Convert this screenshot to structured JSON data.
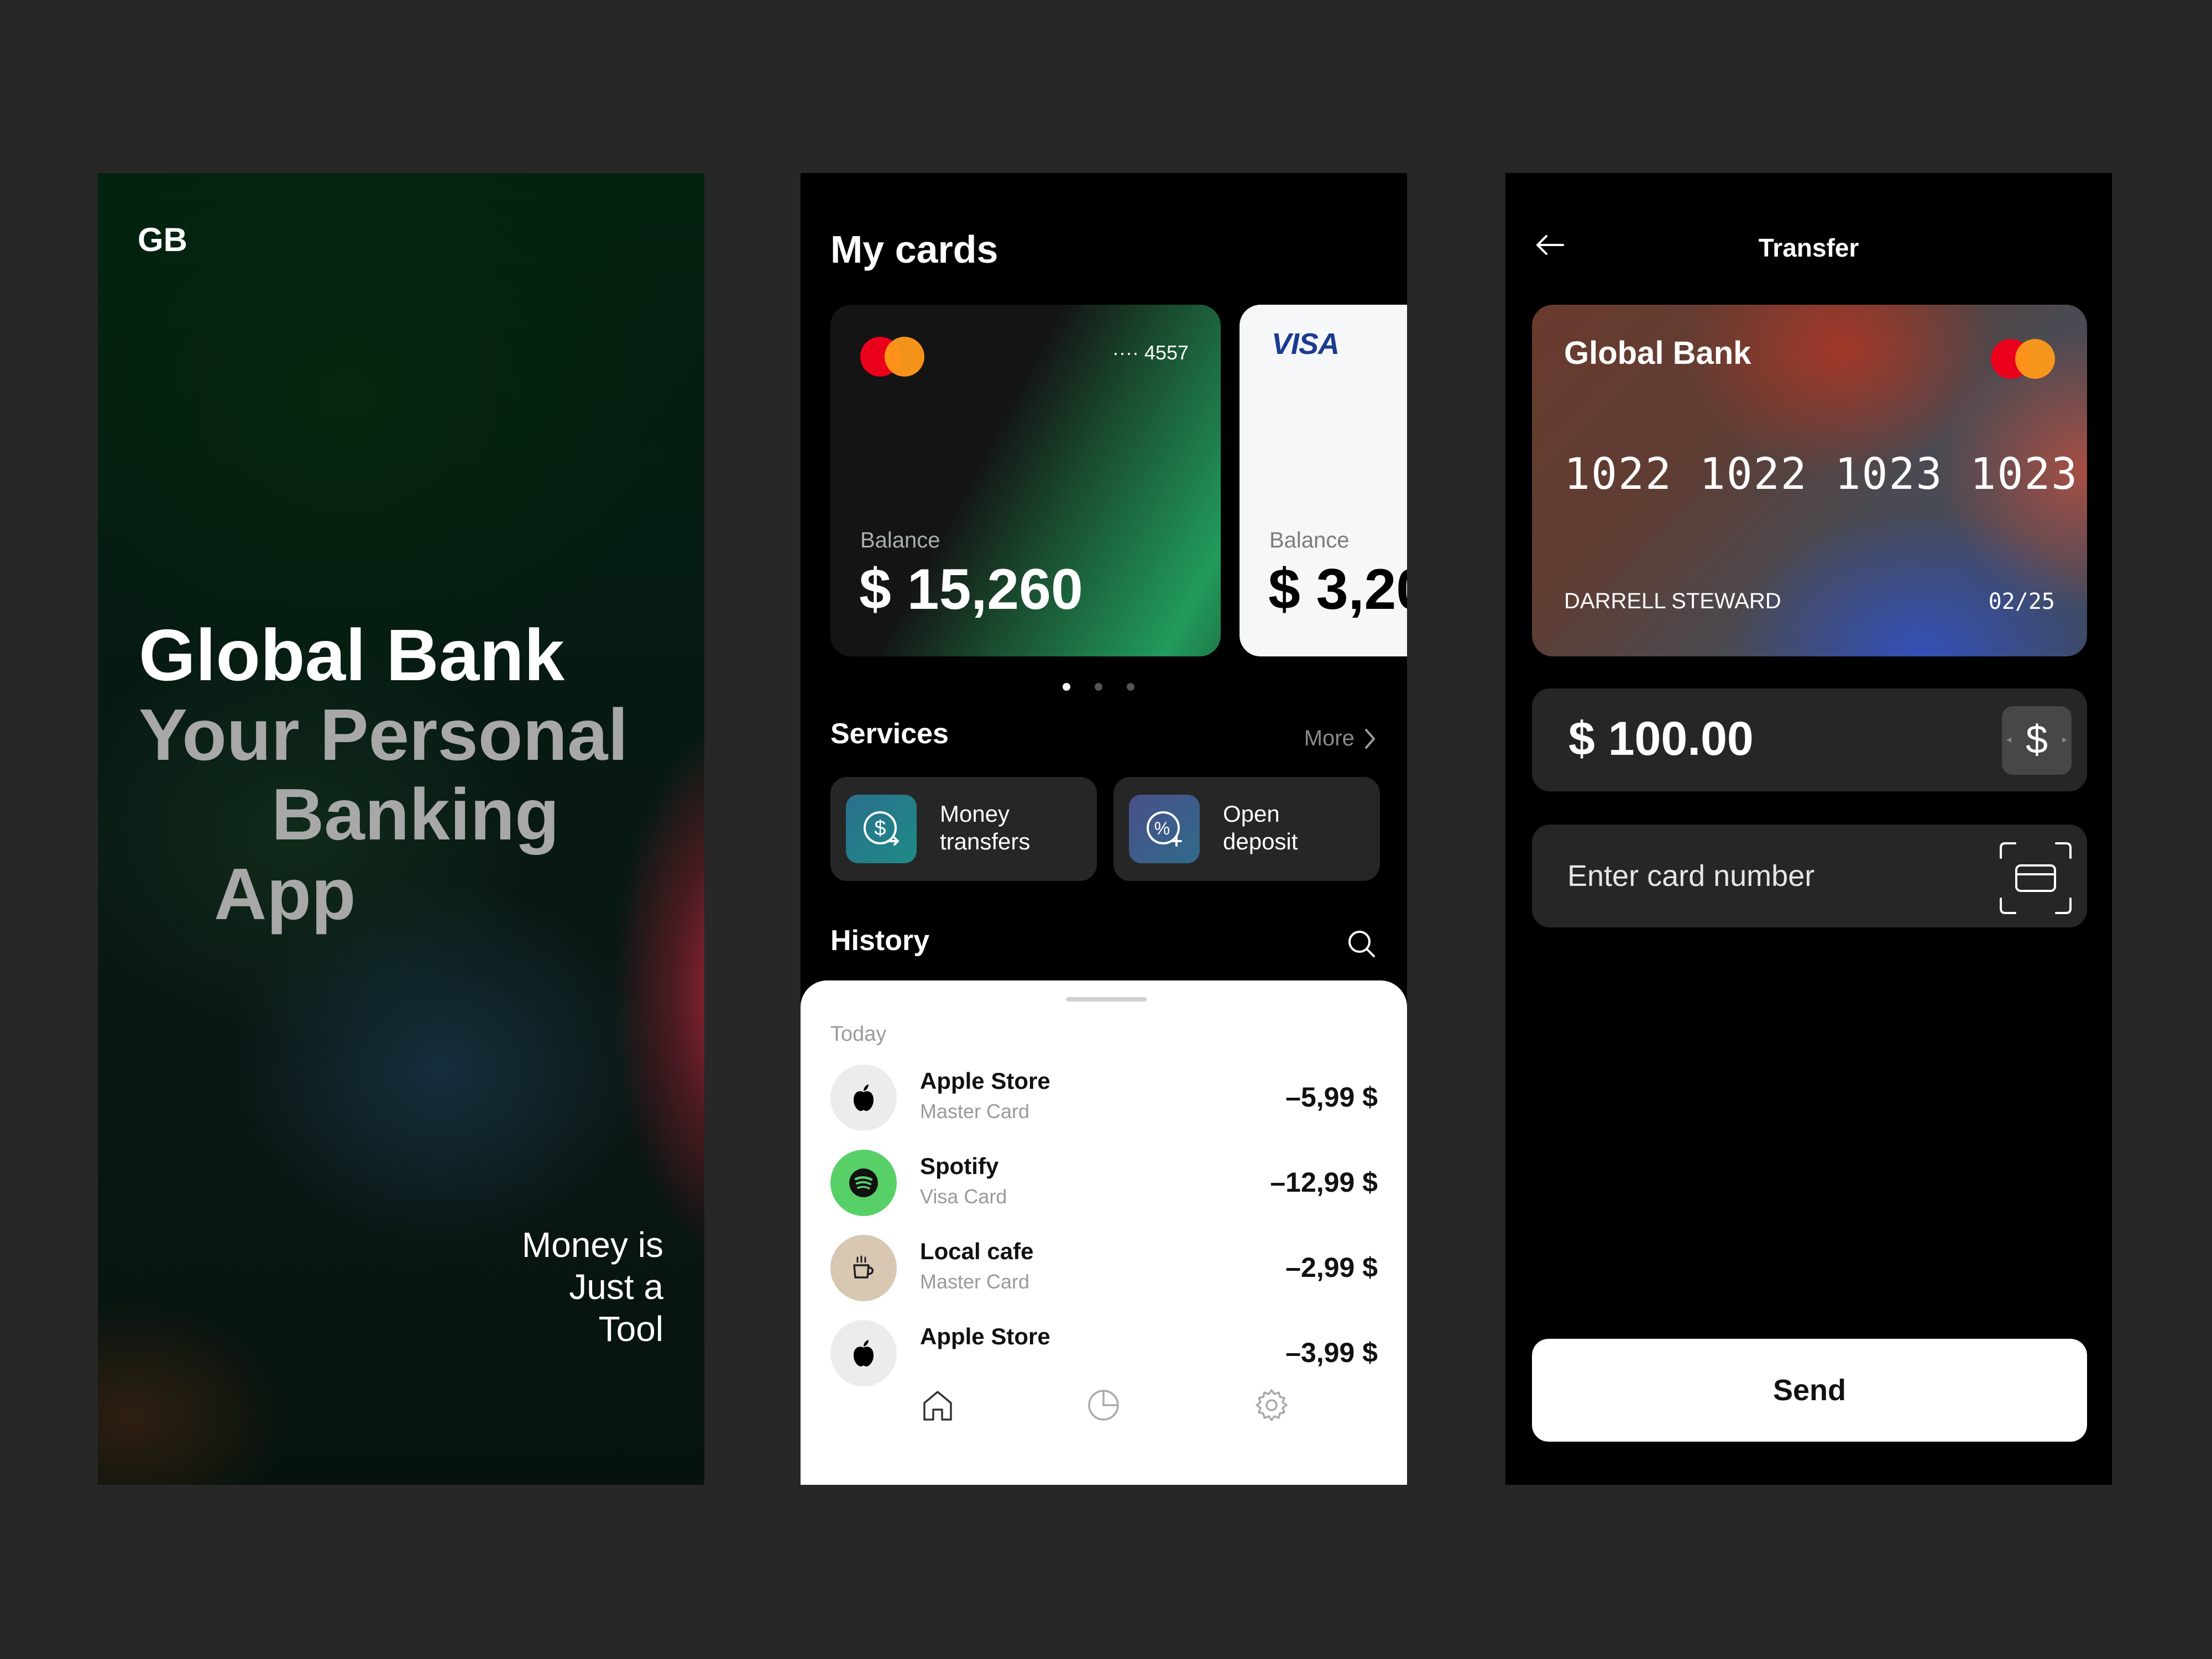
{
  "colors": {
    "page_bg": "#272727",
    "screen_bg": "#000000",
    "surface": "#262626",
    "accent_green": "#219b5b",
    "spotify_green": "#58d068",
    "mastercard_red": "#eb001b",
    "mastercard_orange": "#ff9a1a"
  },
  "splash": {
    "logo": "GB",
    "title": "Global Bank",
    "subtitle_line1": "Your Personal",
    "subtitle_line2": "Banking",
    "subtitle_line3": "App",
    "tagline_line1": "Money is",
    "tagline_line2": "Just a",
    "tagline_line3": "Tool"
  },
  "cards_screen": {
    "title": "My cards",
    "cards": [
      {
        "brand": "mastercard-logo",
        "number_tail": "···· 4557",
        "balance_label": "Balance",
        "balance": "$ 15,260"
      },
      {
        "brand": "VISA",
        "balance_label": "Balance",
        "balance": "$ 3,20"
      }
    ],
    "pagination": {
      "count": 3,
      "active": 0
    },
    "services": {
      "title": "Services",
      "more_label": "More",
      "items": [
        {
          "icon": "dollar-transfer-icon",
          "label_line1": "Money",
          "label_line2": "transfers"
        },
        {
          "icon": "percent-deposit-icon",
          "label_line1": "Open",
          "label_line2": "deposit"
        }
      ]
    },
    "history": {
      "title": "History",
      "search_icon": "search-icon",
      "group_label": "Today",
      "transactions": [
        {
          "icon": "apple-icon",
          "name": "Apple Store",
          "card": "Master Card",
          "amount": "–5,99 $"
        },
        {
          "icon": "spotify-icon",
          "name": "Spotify",
          "card": "Visa Card",
          "amount": "–12,99 $"
        },
        {
          "icon": "coffee-icon",
          "name": "Local cafe",
          "card": "Master Card",
          "amount": "–2,99 $"
        },
        {
          "icon": "apple-icon",
          "name": "Apple Store",
          "card": "",
          "amount": "–3,99 $"
        }
      ]
    },
    "bottom_nav": [
      "home-icon",
      "pie-chart-icon",
      "settings-icon"
    ]
  },
  "transfer_screen": {
    "title": "Transfer",
    "back_icon": "arrow-left-icon",
    "card": {
      "bank": "Global Bank",
      "number": "1022 1022 1023 1023",
      "holder": "DARRELL STEWARD",
      "expiry": "02/25"
    },
    "amount": "$ 100.00",
    "currency_symbol": "$",
    "card_input_placeholder": "Enter card number",
    "scan_icon": "card-scan-icon",
    "send_label": "Send"
  }
}
